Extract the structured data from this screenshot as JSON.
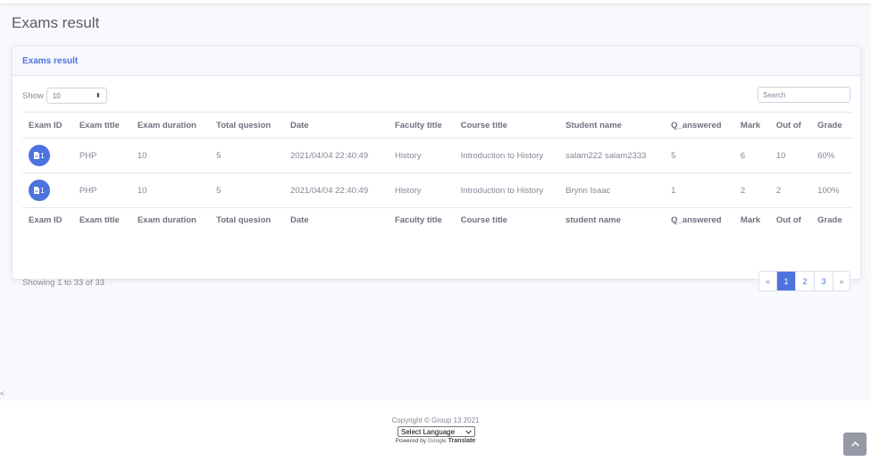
{
  "page": {
    "title": "Exams result"
  },
  "card": {
    "header": "Exams result"
  },
  "controls": {
    "show_label": "Show",
    "show_value": "10",
    "search_placeholder": "Search"
  },
  "table": {
    "headers": [
      "Exam ID",
      "Exam title",
      "Exam duration",
      "Total quesion",
      "Date",
      "Faculty title",
      "Course title",
      "Student name",
      "Q_answered",
      "Mark",
      "Out of",
      "Grade"
    ],
    "footers": [
      "Exam ID",
      "Exam title",
      "Exam duration",
      "Total quesion",
      "Date",
      "Faculty title",
      "Course title",
      "student name",
      "Q_answered",
      "Mark",
      "Out of",
      "Grade"
    ],
    "rows": [
      {
        "id": "1",
        "title": "PHP",
        "duration": "10",
        "total": "5",
        "date": "2021/04/04 22:40:49",
        "faculty": "History",
        "course": "Introduction to History",
        "student": "salam222 salam2333",
        "answered": "5",
        "mark": "6",
        "out_of": "10",
        "grade": "60%"
      },
      {
        "id": "1",
        "title": "PHP",
        "duration": "10",
        "total": "5",
        "date": "2021/04/04 22:40:49",
        "faculty": "History",
        "course": "Introduction to History",
        "student": "Brynn Isaac",
        "answered": "1",
        "mark": "2",
        "out_of": "2",
        "grade": "100%"
      }
    ]
  },
  "info": {
    "showing": "Showing 1 to 33 of 33"
  },
  "pagination": {
    "prev": "«",
    "pages": [
      "1",
      "2",
      "3"
    ],
    "next": "»",
    "active": "1"
  },
  "side": {
    "caret": "<"
  },
  "footer": {
    "copyright": "Copyright © Group 13 2021",
    "language": "Select Language",
    "powered_by": "Powered by",
    "google": "Google",
    "translate": "Translate"
  },
  "colors": {
    "primary": "#4e73df",
    "text": "#858796",
    "heading": "#5a5c69"
  },
  "icons": {
    "exam_badge": "document-icon",
    "scroll_top": "chevron-up-icon"
  }
}
